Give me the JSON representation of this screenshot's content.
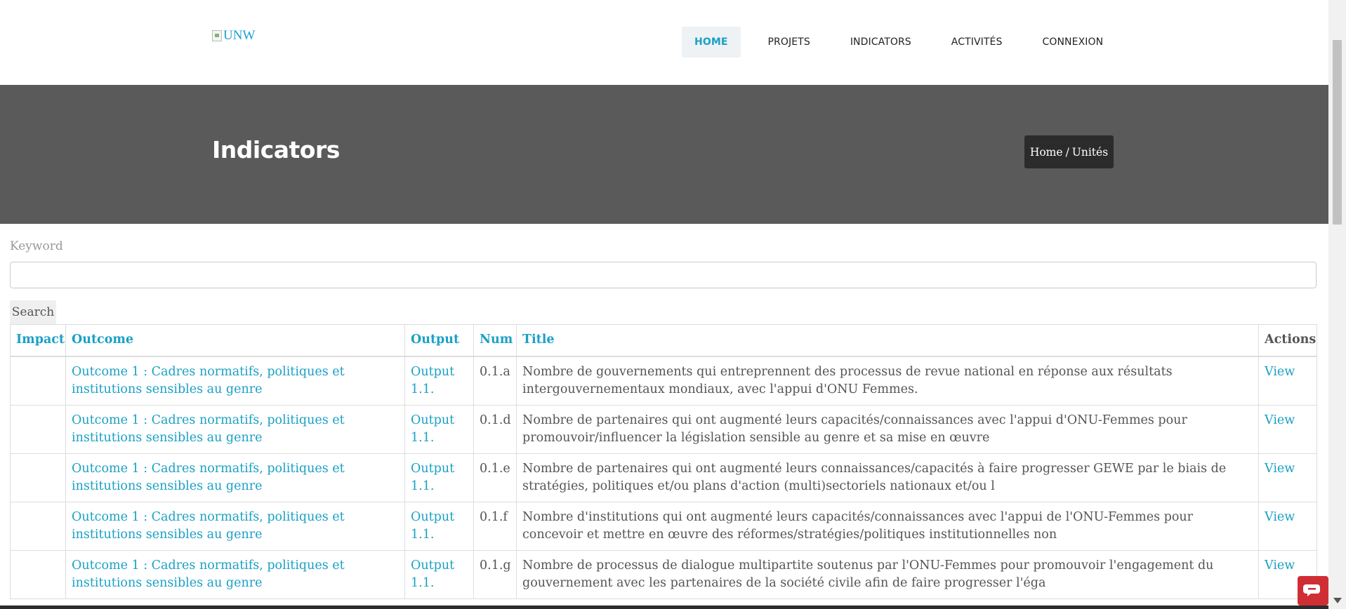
{
  "header": {
    "logo_alt": "UNW",
    "nav": [
      {
        "label": "HOME",
        "active": true
      },
      {
        "label": "PROJETS"
      },
      {
        "label": "INDICATORS"
      },
      {
        "label": "ACTIVITÉS"
      },
      {
        "label": "CONNEXION"
      }
    ]
  },
  "banner": {
    "title": "Indicators",
    "breadcrumb": {
      "home": "Home",
      "separator": "/",
      "current": "Unités"
    }
  },
  "search": {
    "label": "Keyword",
    "value": "",
    "button_label": "Search"
  },
  "table": {
    "headers": {
      "impact": "Impact",
      "outcome": "Outcome",
      "output": "Output",
      "num": "Num",
      "title": "Title",
      "actions": "Actions"
    },
    "rows": [
      {
        "impact": "",
        "outcome": "Outcome 1 : Cadres normatifs, politiques et institutions sensibles au genre",
        "output": "Output 1.1.",
        "num": "0.1.a",
        "title": "Nombre de gouvernements qui entreprennent des processus de revue national en réponse aux résultats intergouvernementaux mondiaux, avec l'appui d'ONU Femmes.",
        "action": "View"
      },
      {
        "impact": "",
        "outcome": "Outcome 1 : Cadres normatifs, politiques et institutions sensibles au genre",
        "output": "Output 1.1.",
        "num": "0.1.d",
        "title": "Nombre de partenaires qui ont augmenté leurs capacités/connaissances avec l'appui d'ONU-Femmes pour promouvoir/influencer la législation sensible au genre et sa mise en œuvre",
        "action": "View"
      },
      {
        "impact": "",
        "outcome": "Outcome 1 : Cadres normatifs, politiques et institutions sensibles au genre",
        "output": "Output 1.1.",
        "num": "0.1.e",
        "title": "Nombre de partenaires qui ont augmenté leurs connaissances/capacités à faire progresser GEWE par le biais de stratégies, politiques et/ou plans d'action (multi)sectoriels nationaux et/ou l",
        "action": "View"
      },
      {
        "impact": "",
        "outcome": "Outcome 1 : Cadres normatifs, politiques et institutions sensibles au genre",
        "output": "Output 1.1.",
        "num": "0.1.f",
        "title": "Nombre d'institutions qui ont augmenté leurs capacités/connaissances avec l'appui de l'ONU-Femmes pour concevoir et mettre en œuvre des réformes/stratégies/politiques institutionnelles non",
        "action": "View"
      },
      {
        "impact": "",
        "outcome": "Outcome 1 : Cadres normatifs, politiques et institutions sensibles au genre",
        "output": "Output 1.1.",
        "num": "0.1.g",
        "title": "Nombre de processus de dialogue multipartite soutenus par l'ONU-Femmes pour promouvoir l'engagement du gouvernement avec les partenaires de la société civile afin de faire progresser l'éga",
        "action": "View"
      }
    ]
  },
  "colors": {
    "accent": "#1ba0c4",
    "banner_bg": "#5a5a5a",
    "breadcrumb_bg": "#2b2b2b",
    "widget": "#d02e35"
  }
}
